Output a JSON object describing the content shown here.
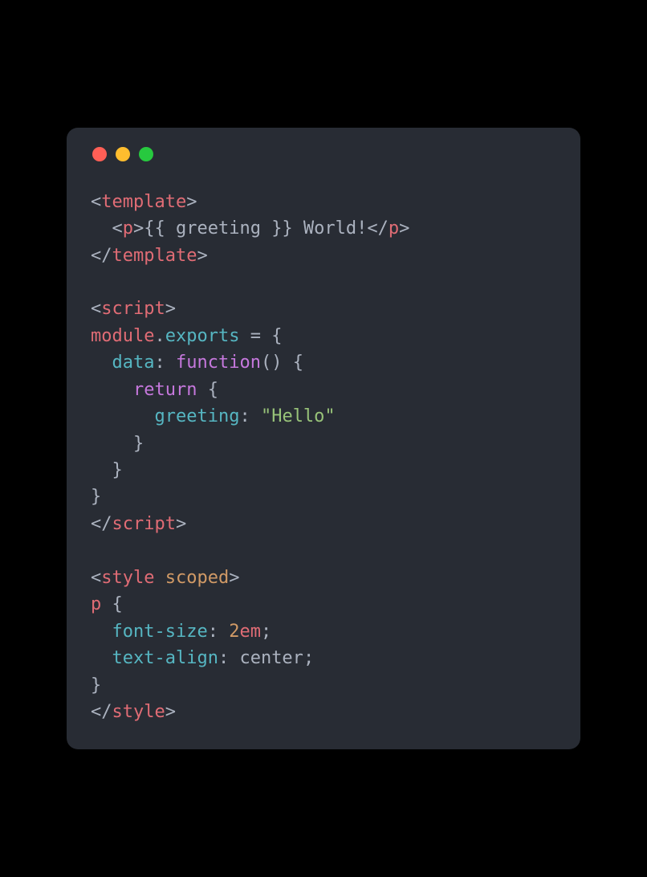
{
  "lines": {
    "l1": {
      "b1": "<",
      "tag1": "template",
      "b2": ">"
    },
    "l2": {
      "indent": "  ",
      "b1": "<",
      "tag1": "p",
      "b2": ">",
      "text": "{{ greeting }} World!",
      "b3": "</",
      "tag2": "p",
      "b4": ">"
    },
    "l3": {
      "b1": "</",
      "tag1": "template",
      "b2": ">"
    },
    "l4": "",
    "l5": {
      "b1": "<",
      "tag1": "script",
      "b2": ">"
    },
    "l6": {
      "ident": "module",
      "dot": ".",
      "method": "exports",
      "eq": " = {"
    },
    "l7": {
      "indent": "  ",
      "prop": "data",
      "colon": ": ",
      "func": "function",
      "paren": "() {"
    },
    "l8": {
      "indent": "    ",
      "keyword": "return",
      "brace": " {"
    },
    "l9": {
      "indent": "      ",
      "prop": "greeting",
      "colon": ": ",
      "string": "\"Hello\""
    },
    "l10": {
      "indent": "    ",
      "brace": "}"
    },
    "l11": {
      "indent": "  ",
      "brace": "}"
    },
    "l12": {
      "brace": "}"
    },
    "l13": {
      "b1": "</",
      "tag1": "script",
      "b2": ">"
    },
    "l14": "",
    "l15": {
      "b1": "<",
      "tag1": "style",
      "sp": " ",
      "attr": "scoped",
      "b2": ">"
    },
    "l16": {
      "sel": "p",
      "brace": " {"
    },
    "l17": {
      "indent": "  ",
      "prop": "font-size",
      "colon": ": ",
      "num": "2",
      "unit": "em",
      "semi": ";"
    },
    "l18": {
      "indent": "  ",
      "prop": "text-align",
      "colon": ": ",
      "val": "center",
      "semi": ";"
    },
    "l19": {
      "brace": "}"
    },
    "l20": {
      "b1": "</",
      "tag1": "style",
      "b2": ">"
    }
  }
}
